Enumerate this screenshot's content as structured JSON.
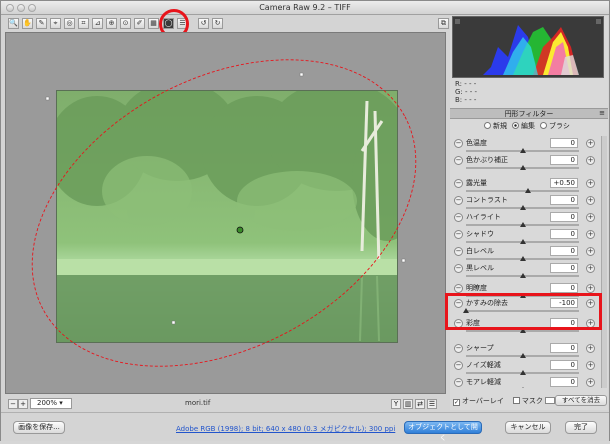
{
  "window": {
    "title": "Camera Raw 9.2  –  TIFF"
  },
  "toolbar": {
    "tools": [
      {
        "icon": "zoom-icon",
        "glyph": "🔍"
      },
      {
        "icon": "hand-icon",
        "glyph": "✋"
      },
      {
        "icon": "white-balance-icon",
        "glyph": "✎"
      },
      {
        "icon": "color-sampler-icon",
        "glyph": "⌖"
      },
      {
        "icon": "target-adjust-icon",
        "glyph": "◎"
      },
      {
        "icon": "crop-icon",
        "glyph": "⌗"
      },
      {
        "icon": "straighten-icon",
        "glyph": "⊿"
      },
      {
        "icon": "spot-removal-icon",
        "glyph": "⊕"
      },
      {
        "icon": "red-eye-icon",
        "glyph": "⊙"
      },
      {
        "icon": "adjustment-brush-icon",
        "glyph": "✐"
      },
      {
        "icon": "graduated-filter-icon",
        "glyph": "▦"
      },
      {
        "icon": "radial-filter-icon",
        "glyph": "◯"
      },
      {
        "icon": "preferences-icon",
        "glyph": "☰"
      },
      {
        "icon": "rotate-left-icon",
        "glyph": "↺"
      },
      {
        "icon": "rotate-right-icon",
        "glyph": "↻"
      }
    ],
    "active_tool_index": 11,
    "preview_toggle_glyph": "⧉"
  },
  "preview": {
    "zoom": "200%",
    "filename": "mori.tif"
  },
  "rgb": {
    "r": "R:  - - -",
    "g": "G:  - - -",
    "b": "B:  - - -"
  },
  "panel": {
    "title": "円形フィルター",
    "modes": [
      {
        "label": "新規",
        "selected": false
      },
      {
        "label": "編集",
        "selected": true
      },
      {
        "label": "ブラシ",
        "selected": false
      }
    ],
    "sliders": [
      {
        "label": "色温度",
        "value": "0",
        "position": 0.5
      },
      {
        "label": "色かぶり補正",
        "value": "0",
        "position": 0.5
      },
      {
        "label": "露光量",
        "value": "+0.50",
        "position": 0.55
      },
      {
        "label": "コントラスト",
        "value": "0",
        "position": 0.5
      },
      {
        "label": "ハイライト",
        "value": "0",
        "position": 0.5
      },
      {
        "label": "シャドウ",
        "value": "0",
        "position": 0.5
      },
      {
        "label": "白レベル",
        "value": "0",
        "position": 0.5
      },
      {
        "label": "黒レベル",
        "value": "0",
        "position": 0.5
      },
      {
        "label": "明瞭度",
        "value": "0",
        "position": 0.5
      },
      {
        "label": "かすみの除去",
        "value": "-100",
        "position": 0.0
      },
      {
        "label": "彩度",
        "value": "0",
        "position": 0.5
      },
      {
        "label": "シャープ",
        "value": "0",
        "position": 0.5
      },
      {
        "label": "ノイズ軽減",
        "value": "0",
        "position": 0.5
      },
      {
        "label": "モアレ軽減",
        "value": "0",
        "position": 0.5
      }
    ],
    "overlay_label": "オーバーレイ",
    "overlay_checked": true,
    "mask_label": "マスク",
    "mask_checked": false,
    "clear_all_label": "すべてを消去"
  },
  "footer": {
    "save_label": "画像を保存...",
    "info_link": "Adobe RGB (1998); 8 bit; 640 x 480 (0.3 メガピクセル); 300 ppi",
    "open_object_label": "オブジェクトとして開く",
    "cancel_label": "キャンセル",
    "done_label": "完了"
  },
  "colors": {
    "highlight": "#e8141b",
    "forest": "#7fb46a"
  }
}
